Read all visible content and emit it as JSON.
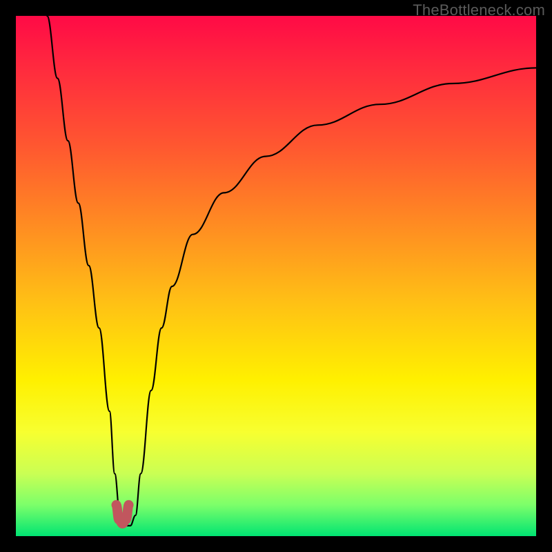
{
  "watermark": "TheBottleneck.com",
  "chart_data": {
    "type": "line",
    "title": "",
    "xlabel": "",
    "ylabel": "",
    "xlim": [
      0,
      100
    ],
    "ylim": [
      0,
      100
    ],
    "series": [
      {
        "name": "bottleneck-curve",
        "x": [
          6,
          8,
          10,
          12,
          14,
          16,
          18,
          19,
          20,
          21,
          22,
          23,
          24,
          26,
          28,
          30,
          34,
          40,
          48,
          58,
          70,
          84,
          100
        ],
        "y": [
          100,
          88,
          76,
          64,
          52,
          40,
          24,
          12,
          4,
          2,
          2,
          4,
          12,
          28,
          40,
          48,
          58,
          66,
          73,
          79,
          83,
          87,
          90
        ]
      },
      {
        "name": "optimal-marker",
        "x": [
          19.3,
          19.8,
          20.5,
          21.2,
          21.7
        ],
        "y": [
          6,
          3.2,
          2.4,
          3.2,
          6
        ]
      }
    ],
    "colors": {
      "curve": "#000000",
      "marker": "#c1565e"
    }
  }
}
